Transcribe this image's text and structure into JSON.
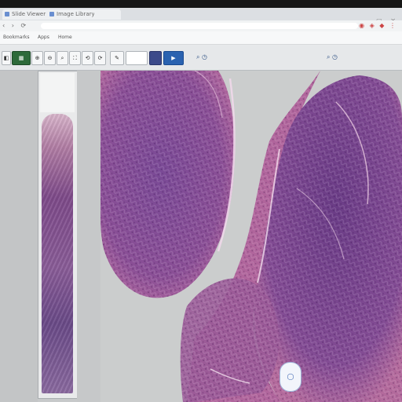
{
  "browser": {
    "tabs": [
      {
        "label": "Slide Viewer"
      },
      {
        "label": "Image Library"
      },
      {
        "label": ""
      }
    ],
    "window_controls": "— ▢ ✕",
    "nav_icons": "‹ › ⟳",
    "url": "",
    "extension_icons": "◉ ◈ ◆ ⋮"
  },
  "bookmarks": [
    {
      "label": "Bookmarks"
    },
    {
      "label": "Apps"
    },
    {
      "label": "Home"
    }
  ],
  "toolbar": {
    "buttons": [
      {
        "label": "◧"
      },
      {
        "label": "▦"
      },
      {
        "label": "⊕"
      },
      {
        "label": "⊖"
      },
      {
        "label": "⌕"
      },
      {
        "label": "⛶"
      },
      {
        "label": "⟲"
      },
      {
        "label": "⟳"
      },
      {
        "label": "✎"
      },
      {
        "label": "▶"
      }
    ],
    "zoom_label": "⌕ ◷",
    "right_label": "⌕ ◷"
  },
  "viewer": {
    "overview_label": "◯"
  },
  "colors": {
    "tissue_dark": "#6a3c86",
    "tissue_mid": "#8a4f96",
    "tissue_pink": "#b56a9e",
    "background": "#cbcdcd"
  }
}
